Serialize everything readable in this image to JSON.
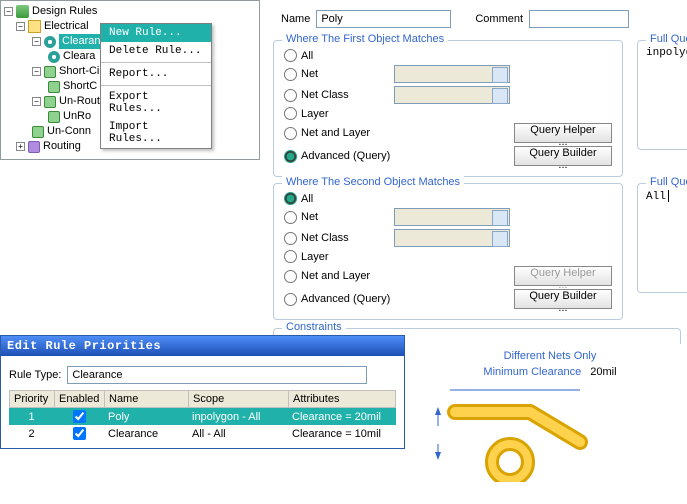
{
  "tree": {
    "root": "Design Rules",
    "electrical": "Electrical",
    "clearance": "Clearanc",
    "clear_sub": "Cleara",
    "short": "Short-Circ",
    "short_sub": "ShortC",
    "unroute": "Un-Route",
    "unroute_sub": "UnRo",
    "unconn": "Un-Conn",
    "routing": "Routing"
  },
  "ctx": {
    "new_rule": "New Rule...",
    "delete_rule": "Delete Rule...",
    "report": "Report...",
    "export": "Export Rules...",
    "import": "Import Rules..."
  },
  "form": {
    "name_lbl": "Name",
    "name_val": "Poly",
    "comment_lbl": "Comment",
    "comment_val": ""
  },
  "matches1": {
    "title": "Where The First Object Matches",
    "all": "All",
    "net": "Net",
    "netclass": "Net Class",
    "layer": "Layer",
    "netlayer": "Net and Layer",
    "advanced": "Advanced (Query)",
    "helper": "Query Helper ...",
    "builder": "Query Builder ..."
  },
  "matches2": {
    "title": "Where The Second Object Matches",
    "all": "All",
    "net": "Net",
    "netclass": "Net Class",
    "layer": "Layer",
    "netlayer": "Net and Layer",
    "advanced": "Advanced (Query)",
    "helper": "Query Helper ...",
    "builder": "Query Builder ..."
  },
  "fullquery": {
    "title": "Full Query",
    "q1": "inpolygon",
    "q2": "All"
  },
  "constraints": {
    "title": "Constraints"
  },
  "erp": {
    "title": "Edit Rule Priorities",
    "type_lbl": "Rule Type:",
    "type_val": "Clearance",
    "cols": {
      "priority": "Priority",
      "enabled": "Enabled",
      "name": "Name",
      "scope": "Scope",
      "attrs": "Attributes"
    },
    "rows": [
      {
        "priority": "1",
        "enabled": true,
        "name": "Poly",
        "scope": "inpolygon   -   All",
        "attrs": "Clearance = 20mil"
      },
      {
        "priority": "2",
        "enabled": true,
        "name": "Clearance",
        "scope": "All   -   All",
        "attrs": "Clearance = 10mil"
      }
    ]
  },
  "diagram": {
    "dno": "Different Nets Only",
    "mc": "Minimum Clearance",
    "mcv": "20mil"
  }
}
